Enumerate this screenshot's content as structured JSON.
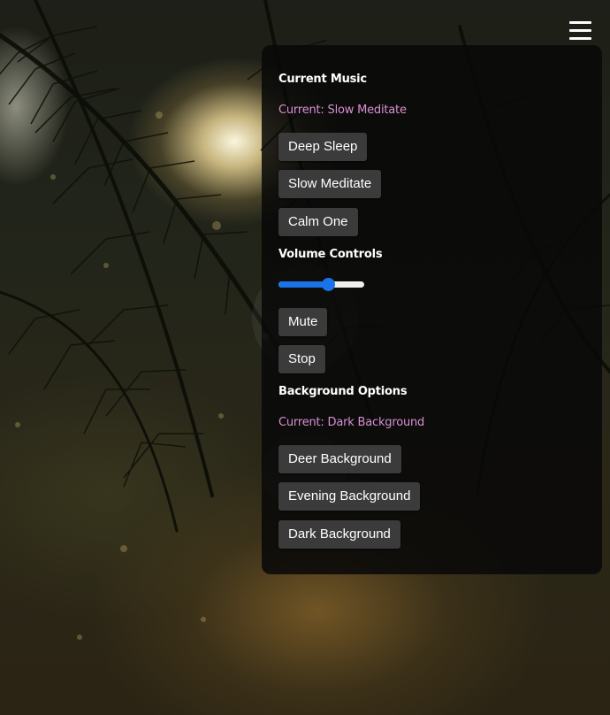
{
  "menu": {
    "icon": "hamburger-menu-icon",
    "music_section": {
      "title": "Current Music",
      "current": "Current: Slow Meditate",
      "tracks": [
        "Deep Sleep",
        "Slow Meditate",
        "Calm One"
      ]
    },
    "volume_section": {
      "title": "Volume Controls",
      "volume_fraction": 0.58,
      "mute_label": "Mute",
      "stop_label": "Stop"
    },
    "background_section": {
      "title": "Background Options",
      "current": "Current: Dark Background",
      "options": [
        "Deer Background",
        "Evening Background",
        "Dark Background"
      ]
    }
  },
  "colors": {
    "accent": "#d98fd2",
    "slider": "#1a73e8",
    "button_bg": "#3b3b3b",
    "panel_bg": "rgba(8,8,8,0.86)"
  }
}
